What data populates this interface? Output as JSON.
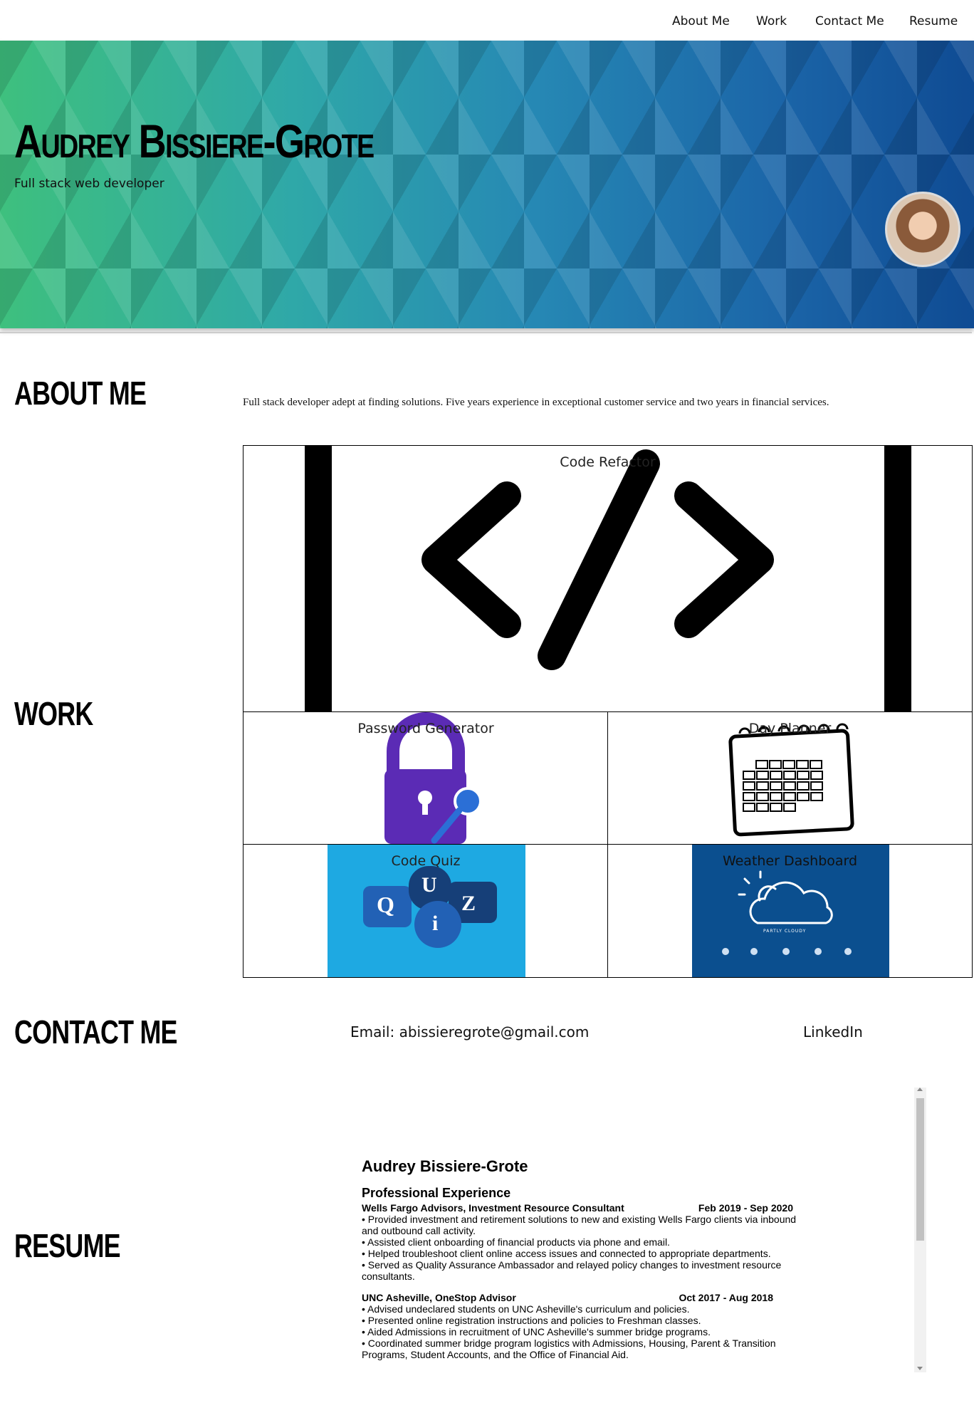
{
  "nav": {
    "items": [
      "About Me",
      "Work",
      "Contact Me",
      "Resume"
    ]
  },
  "hero": {
    "name": "Audrey Bissiere-Grote",
    "subtitle": "Full stack web developer"
  },
  "sections": {
    "about": "About Me",
    "work": "Work",
    "contact": "Contact Me",
    "resume": "Resume"
  },
  "about": {
    "text": "Full stack developer adept at finding solutions. Five years experience in exceptional customer service and two years in financial services."
  },
  "work": {
    "projects": [
      {
        "title": "Code Refactor"
      },
      {
        "title": "Password Generator"
      },
      {
        "title": "Day Planner"
      },
      {
        "title": "Code Quiz"
      },
      {
        "title": "Weather Dashboard"
      }
    ],
    "quiz_letters": [
      "Q",
      "U",
      "i",
      "Z"
    ],
    "weather_caption": "PARTLY CLOUDY"
  },
  "contact": {
    "email": "Email: abissieregrote@gmail.com",
    "linkedin": "LinkedIn"
  },
  "resume": {
    "name": "Audrey Bissiere-Grote",
    "section_title": "Professional Experience",
    "jobs": [
      {
        "title": "Wells Fargo Advisors, Investment Resource Consultant",
        "dates": "Feb 2019 - Sep 2020",
        "bullets": [
          "• Provided investment and retirement solutions to new and existing Wells Fargo clients via inbound and outbound call activity.",
          "• Assisted client onboarding of financial products via phone and email.",
          "• Helped troubleshoot client online access issues and connected to appropriate departments.",
          "• Served as Quality Assurance Ambassador and relayed policy changes to investment resource consultants."
        ]
      },
      {
        "title": "UNC Asheville, OneStop Advisor",
        "dates": "Oct 2017 - Aug 2018",
        "bullets": [
          "• Advised undeclared students on UNC Asheville's curriculum and policies.",
          "• Presented online registration instructions and policies to Freshman classes.",
          "• Aided Admissions in recruitment of UNC Asheville's summer bridge programs.",
          "• Coordinated summer bridge program logistics with Admissions, Housing, Parent & Transition Programs, Student Accounts, and the Office of Financial Aid."
        ]
      }
    ]
  },
  "colors": {
    "hero_start": "#3ec07e",
    "hero_end": "#0f4b93",
    "lock_purple": "#5b2bb5",
    "key_blue": "#2b6fd6",
    "quiz_bg": "#1ea9e2",
    "weather_bg": "#0b4f8f"
  }
}
